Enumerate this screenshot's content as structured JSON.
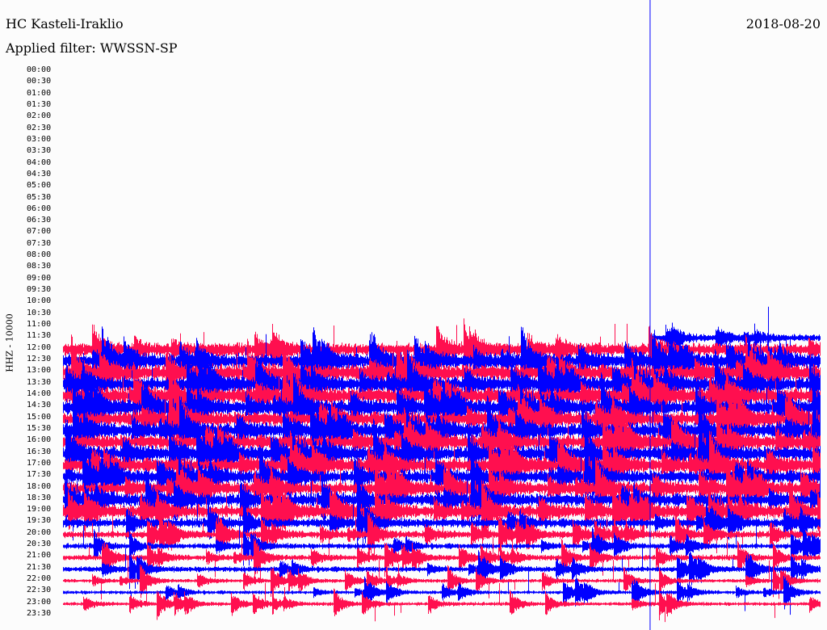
{
  "header": {
    "station": "HC Kasteli-Iraklio",
    "filter": "Applied filter: WWSSN-SP",
    "date": "2018-08-20"
  },
  "chart_data": {
    "type": "line",
    "title": "HC Kasteli-Iraklio",
    "ylabel": "HHZ - 10000",
    "row_labels": [
      "00:00",
      "00:30",
      "01:00",
      "01:30",
      "02:00",
      "02:30",
      "03:00",
      "03:30",
      "04:00",
      "04:30",
      "05:00",
      "05:30",
      "06:00",
      "06:30",
      "07:00",
      "07:30",
      "08:00",
      "08:30",
      "09:00",
      "09:30",
      "10:00",
      "10:30",
      "11:00",
      "11:30",
      "12:00",
      "12:30",
      "13:00",
      "13:30",
      "14:00",
      "14:30",
      "15:00",
      "15:30",
      "16:00",
      "16:30",
      "17:00",
      "17:30",
      "18:00",
      "18:30",
      "19:00",
      "19:30",
      "20:00",
      "20:30",
      "21:00",
      "21:30",
      "22:00",
      "22:30",
      "23:00",
      "23:30"
    ],
    "colors": {
      "odd": "#ff0f4f",
      "even": "#0000ff",
      "marker": "#0000ff"
    },
    "current_time_fraction": 0.775,
    "traces": [
      {
        "row": "11:30",
        "color": "even",
        "start_fraction": 0.775,
        "amplitude": 4
      },
      {
        "row": "12:00",
        "color": "odd",
        "start_fraction": 0,
        "amplitude": 7
      },
      {
        "row": "12:30",
        "color": "even",
        "start_fraction": 0,
        "amplitude": 8
      },
      {
        "row": "13:00",
        "color": "odd",
        "start_fraction": 0,
        "amplitude": 9
      },
      {
        "row": "13:30",
        "color": "even",
        "start_fraction": 0,
        "amplitude": 8
      },
      {
        "row": "14:00",
        "color": "odd",
        "start_fraction": 0,
        "amplitude": 9
      },
      {
        "row": "14:30",
        "color": "even",
        "start_fraction": 0,
        "amplitude": 8
      },
      {
        "row": "15:00",
        "color": "odd",
        "start_fraction": 0,
        "amplitude": 8
      },
      {
        "row": "15:30",
        "color": "even",
        "start_fraction": 0,
        "amplitude": 8
      },
      {
        "row": "16:00",
        "color": "odd",
        "start_fraction": 0,
        "amplitude": 8
      },
      {
        "row": "16:30",
        "color": "even",
        "start_fraction": 0,
        "amplitude": 8
      },
      {
        "row": "17:00",
        "color": "odd",
        "start_fraction": 0,
        "amplitude": 8
      },
      {
        "row": "17:30",
        "color": "even",
        "start_fraction": 0,
        "amplitude": 7
      },
      {
        "row": "18:00",
        "color": "odd",
        "start_fraction": 0,
        "amplitude": 7
      },
      {
        "row": "18:30",
        "color": "even",
        "start_fraction": 0,
        "amplitude": 7
      },
      {
        "row": "19:00",
        "color": "odd",
        "start_fraction": 0,
        "amplitude": 7
      },
      {
        "row": "19:30",
        "color": "even",
        "start_fraction": 0,
        "amplitude": 5
      },
      {
        "row": "20:00",
        "color": "odd",
        "start_fraction": 0,
        "amplitude": 4
      },
      {
        "row": "20:30",
        "color": "even",
        "start_fraction": 0,
        "amplitude": 3
      },
      {
        "row": "21:00",
        "color": "odd",
        "start_fraction": 0,
        "amplitude": 3
      },
      {
        "row": "21:30",
        "color": "even",
        "start_fraction": 0,
        "amplitude": 3
      },
      {
        "row": "22:00",
        "color": "odd",
        "start_fraction": 0,
        "amplitude": 2
      },
      {
        "row": "22:30",
        "color": "even",
        "start_fraction": 0,
        "amplitude": 2
      },
      {
        "row": "23:00",
        "color": "odd",
        "start_fraction": 0,
        "amplitude": 2
      }
    ]
  }
}
